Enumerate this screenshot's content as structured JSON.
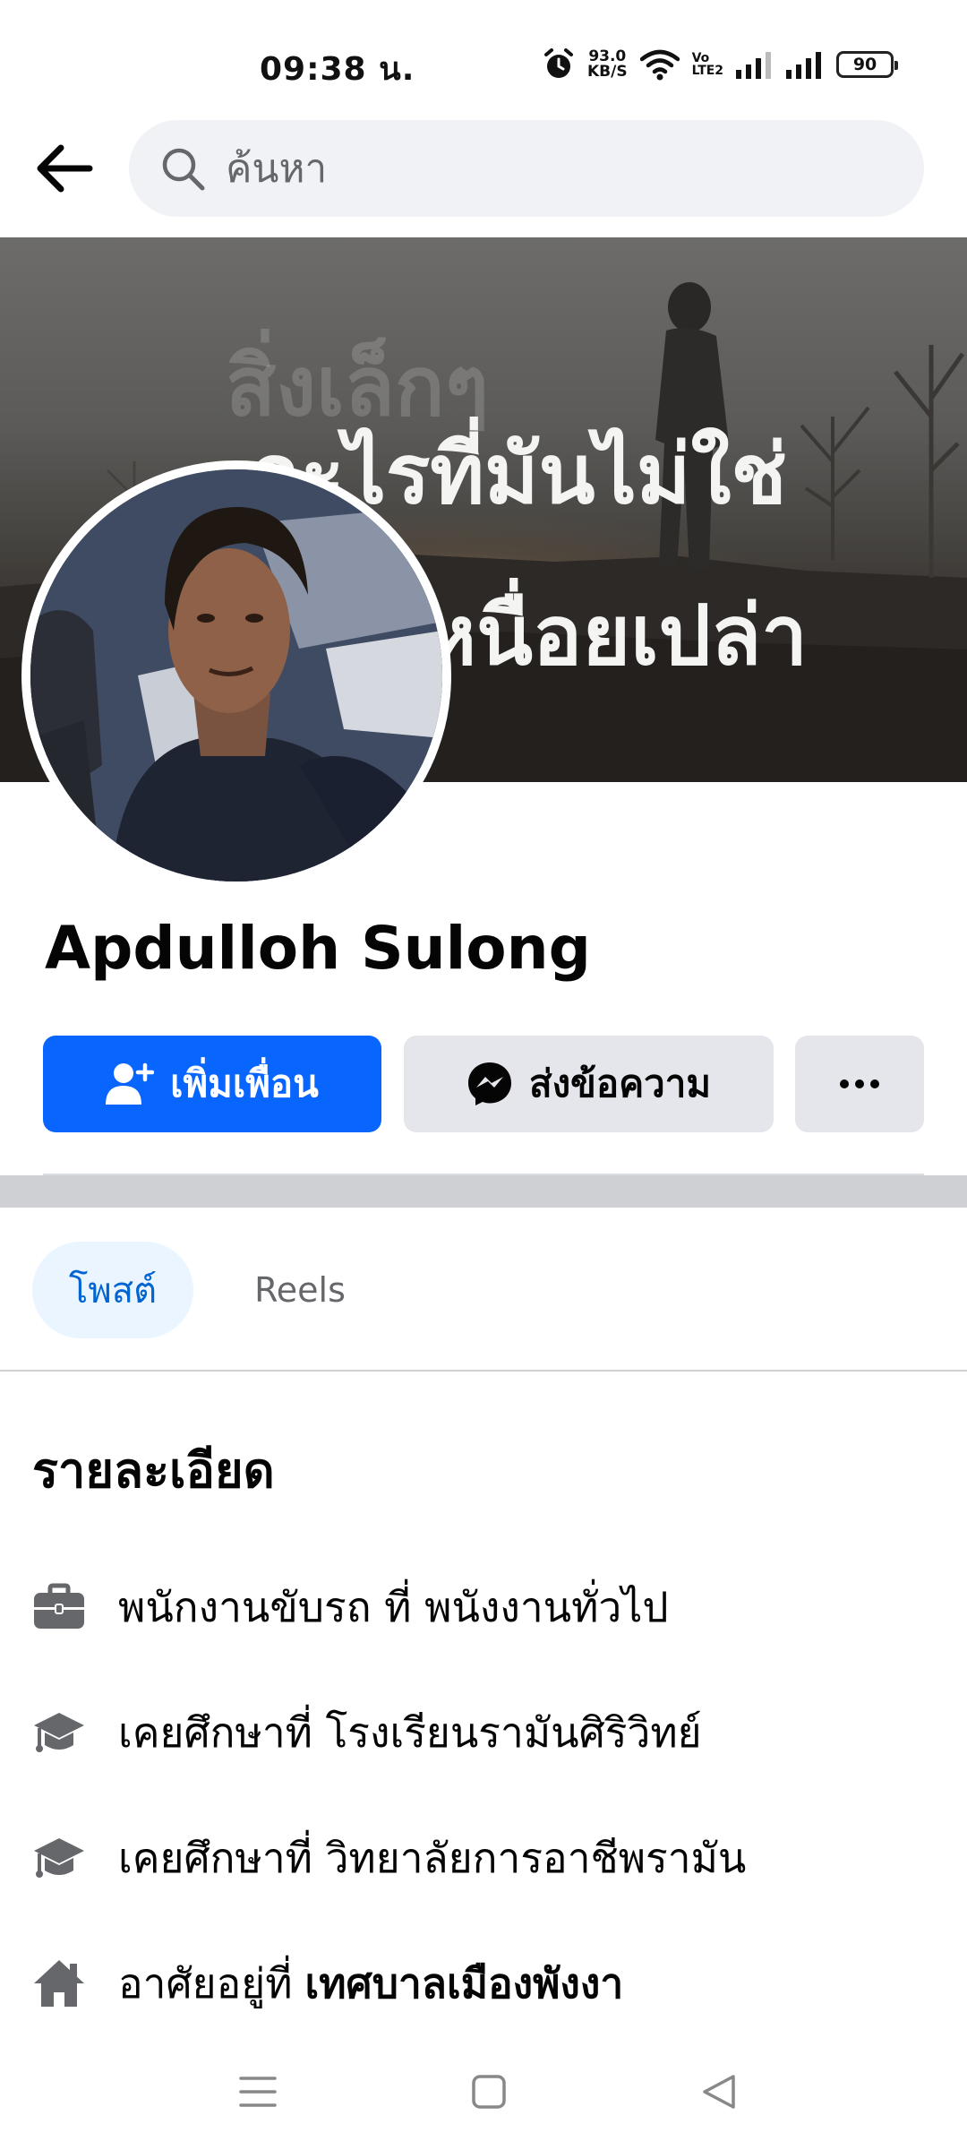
{
  "status_bar": {
    "time": "09:38 น.",
    "net_speed_value": "93.0",
    "net_speed_unit": "KB/S",
    "volte_top": "Vo",
    "volte_bottom": "LTE2",
    "battery": "90"
  },
  "search": {
    "placeholder": "ค้นหา"
  },
  "cover": {
    "faded_text": "สิ่งเล็กๆ",
    "line1": "อะไรที่มันไม่ใช่",
    "line2": "เหนื่อยเปล่า"
  },
  "profile": {
    "name": "Apdulloh Sulong"
  },
  "actions": {
    "add_friend": "เพิ่มเพื่อน",
    "message": "ส่งข้อความ"
  },
  "tabs": [
    {
      "label": "โพสต์",
      "active": true
    },
    {
      "label": "Reels",
      "active": false
    }
  ],
  "details": {
    "title": "รายละเอียด",
    "items": [
      {
        "icon": "briefcase-icon",
        "text": "พนักงานขับรถ ที่ พนังงานทั่วไป",
        "bold": ""
      },
      {
        "icon": "graduation-cap-icon",
        "text": "เคยศึกษาที่ โรงเรียนรามันศิริวิทย์",
        "bold": ""
      },
      {
        "icon": "graduation-cap-icon",
        "text": "เคยศึกษาที่ วิทยาลัยการอาชีพรามัน",
        "bold": ""
      },
      {
        "icon": "home-icon",
        "text": "อาศัยอยู่ที่",
        "bold": "เทศบาลเมืองพังงา"
      }
    ]
  },
  "colors": {
    "primary": "#0866ff",
    "secondary_button": "#e4e6eb",
    "active_tab_bg": "#ebf5ff",
    "active_tab_text": "#0064d1",
    "icon_gray": "#65676b"
  }
}
